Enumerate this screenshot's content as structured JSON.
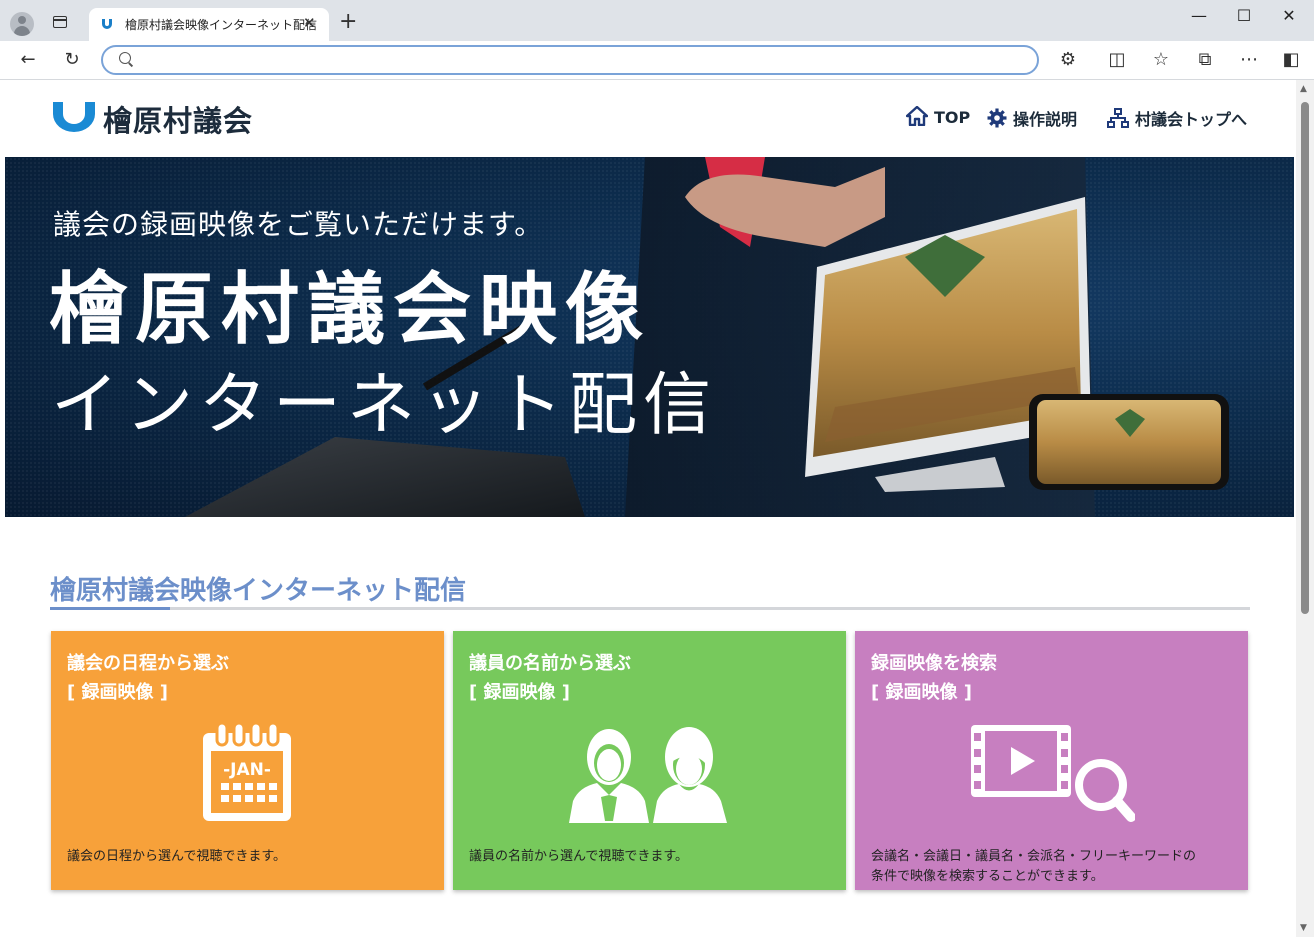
{
  "browser": {
    "tab_title": "檜原村議会映像インターネット配信",
    "tab_close": "✕",
    "new_tab": "+",
    "address_value": "",
    "window_minimize": "—",
    "window_maximize": "☐",
    "window_close": "✕"
  },
  "site": {
    "logo_text": "檜原村議会",
    "nav": [
      {
        "label": "TOP",
        "icon": "home-icon"
      },
      {
        "label": "操作説明",
        "icon": "gear-icon"
      },
      {
        "label": "村議会トップへ",
        "icon": "sitemap-icon"
      }
    ]
  },
  "hero": {
    "subtitle": "議会の録画映像をご覧いただけます。",
    "title_line1": "檜原村議会映像",
    "title_line2": "インターネット配信"
  },
  "section": {
    "title": "檜原村議会映像インターネット配信"
  },
  "cards": [
    {
      "title": "議会の日程から選ぶ",
      "sub": "[ 録画映像 ]",
      "desc": "議会の日程から選んで視聴できます。",
      "desc2": "",
      "color": "#f7a13a",
      "icon": "calendar-icon",
      "icon_label": "-JAN-"
    },
    {
      "title": "議員の名前から選ぶ",
      "sub": "[ 録画映像 ]",
      "desc": "議員の名前から選んで視聴できます。",
      "desc2": "",
      "color": "#77c95c",
      "icon": "people-icon"
    },
    {
      "title": "録画映像を検索",
      "sub": "[ 録画映像 ]",
      "desc": "会議名・会議日・議員名・会派名・フリーキーワードの",
      "desc2": "条件で映像を検索することができます。",
      "color": "#c77fc0",
      "icon": "video-search-icon"
    }
  ]
}
